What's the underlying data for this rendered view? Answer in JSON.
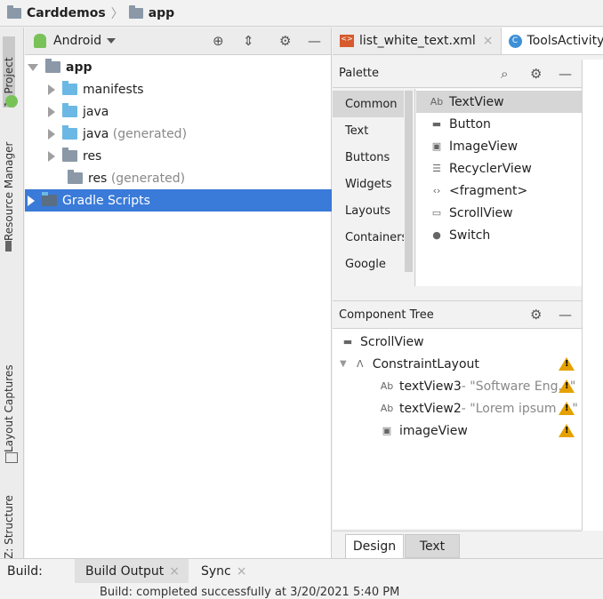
{
  "breadcrumb": {
    "project": "Carddemos",
    "module": "app"
  },
  "left_stripe": {
    "project_tab": "1: Project",
    "resource_manager": "Resource Manager",
    "layout_captures": "Layout Captures",
    "structure": "Z: Structure"
  },
  "project_panel": {
    "view_mode": "Android",
    "tree": [
      {
        "label": "app",
        "bold": true
      },
      {
        "label": "manifests"
      },
      {
        "label": "java"
      },
      {
        "label": "java",
        "suffix": "(generated)"
      },
      {
        "label": "res"
      },
      {
        "label": "res",
        "suffix": "(generated)"
      },
      {
        "label": "Gradle Scripts",
        "selected": true
      }
    ]
  },
  "editor_tabs": [
    {
      "label": "list_white_text.xml"
    },
    {
      "label": "ToolsActivity."
    }
  ],
  "palette": {
    "title": "Palette",
    "categories": [
      "Common",
      "Text",
      "Buttons",
      "Widgets",
      "Layouts",
      "Containers",
      "Google"
    ],
    "widgets": [
      {
        "label": "TextView",
        "icon": "Ab"
      },
      {
        "label": "Button",
        "icon": "button-icon"
      },
      {
        "label": "ImageView",
        "icon": "image-icon"
      },
      {
        "label": "RecyclerView",
        "icon": "list-icon"
      },
      {
        "label": "<fragment>",
        "icon": "fragment-icon"
      },
      {
        "label": "ScrollView",
        "icon": "scroll-icon"
      },
      {
        "label": "Switch",
        "icon": "switch-icon"
      }
    ]
  },
  "component_tree": {
    "title": "Component Tree",
    "items": [
      {
        "label": "ScrollView"
      },
      {
        "label": "ConstraintLayout"
      },
      {
        "label": "textView3",
        "hint": "- \"Software Eng...\""
      },
      {
        "label": "textView2",
        "hint": "- \"Lorem ipsum ...\""
      },
      {
        "label": "imageView"
      }
    ]
  },
  "design_tabs": {
    "design": "Design",
    "text": "Text"
  },
  "build_bar": {
    "label": "Build:",
    "output_tab": "Build Output",
    "sync_tab": "Sync",
    "status": "Build: completed successfully at 3/20/2021 5:40 PM"
  },
  "colors": {
    "selection": "#3a7ad8",
    "warning": "#e5a100"
  }
}
